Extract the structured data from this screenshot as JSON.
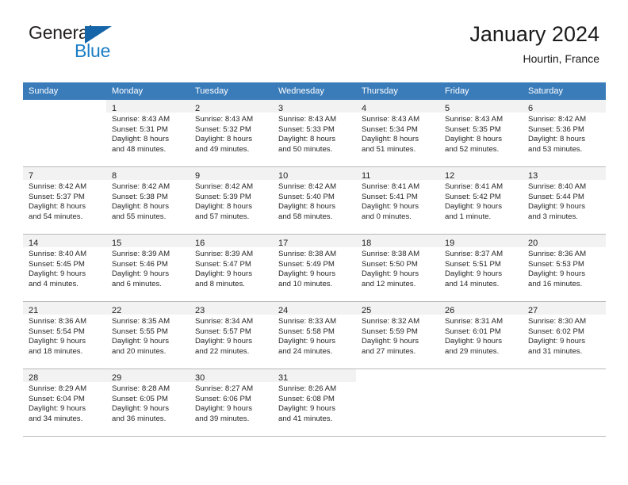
{
  "brand": {
    "name_part1": "General",
    "name_part2": "Blue",
    "accent_color": "#1a7dc4",
    "flag_color": "#1565a8"
  },
  "header": {
    "title": "January 2024",
    "subtitle": "Hourtin, France"
  },
  "calendar": {
    "header_bg": "#3a7cba",
    "daynum_strip_bg": "#f2f2f2",
    "grid_line_color": "#b9b9b9",
    "weekday_headers": [
      "Sunday",
      "Monday",
      "Tuesday",
      "Wednesday",
      "Thursday",
      "Friday",
      "Saturday"
    ],
    "weeks": [
      [
        {
          "empty": true
        },
        {
          "day": "1",
          "sunrise": "Sunrise: 8:43 AM",
          "sunset": "Sunset: 5:31 PM",
          "daylight_line1": "Daylight: 8 hours",
          "daylight_line2": "and 48 minutes."
        },
        {
          "day": "2",
          "sunrise": "Sunrise: 8:43 AM",
          "sunset": "Sunset: 5:32 PM",
          "daylight_line1": "Daylight: 8 hours",
          "daylight_line2": "and 49 minutes."
        },
        {
          "day": "3",
          "sunrise": "Sunrise: 8:43 AM",
          "sunset": "Sunset: 5:33 PM",
          "daylight_line1": "Daylight: 8 hours",
          "daylight_line2": "and 50 minutes."
        },
        {
          "day": "4",
          "sunrise": "Sunrise: 8:43 AM",
          "sunset": "Sunset: 5:34 PM",
          "daylight_line1": "Daylight: 8 hours",
          "daylight_line2": "and 51 minutes."
        },
        {
          "day": "5",
          "sunrise": "Sunrise: 8:43 AM",
          "sunset": "Sunset: 5:35 PM",
          "daylight_line1": "Daylight: 8 hours",
          "daylight_line2": "and 52 minutes."
        },
        {
          "day": "6",
          "sunrise": "Sunrise: 8:42 AM",
          "sunset": "Sunset: 5:36 PM",
          "daylight_line1": "Daylight: 8 hours",
          "daylight_line2": "and 53 minutes."
        }
      ],
      [
        {
          "day": "7",
          "sunrise": "Sunrise: 8:42 AM",
          "sunset": "Sunset: 5:37 PM",
          "daylight_line1": "Daylight: 8 hours",
          "daylight_line2": "and 54 minutes."
        },
        {
          "day": "8",
          "sunrise": "Sunrise: 8:42 AM",
          "sunset": "Sunset: 5:38 PM",
          "daylight_line1": "Daylight: 8 hours",
          "daylight_line2": "and 55 minutes."
        },
        {
          "day": "9",
          "sunrise": "Sunrise: 8:42 AM",
          "sunset": "Sunset: 5:39 PM",
          "daylight_line1": "Daylight: 8 hours",
          "daylight_line2": "and 57 minutes."
        },
        {
          "day": "10",
          "sunrise": "Sunrise: 8:42 AM",
          "sunset": "Sunset: 5:40 PM",
          "daylight_line1": "Daylight: 8 hours",
          "daylight_line2": "and 58 minutes."
        },
        {
          "day": "11",
          "sunrise": "Sunrise: 8:41 AM",
          "sunset": "Sunset: 5:41 PM",
          "daylight_line1": "Daylight: 9 hours",
          "daylight_line2": "and 0 minutes."
        },
        {
          "day": "12",
          "sunrise": "Sunrise: 8:41 AM",
          "sunset": "Sunset: 5:42 PM",
          "daylight_line1": "Daylight: 9 hours",
          "daylight_line2": "and 1 minute."
        },
        {
          "day": "13",
          "sunrise": "Sunrise: 8:40 AM",
          "sunset": "Sunset: 5:44 PM",
          "daylight_line1": "Daylight: 9 hours",
          "daylight_line2": "and 3 minutes."
        }
      ],
      [
        {
          "day": "14",
          "sunrise": "Sunrise: 8:40 AM",
          "sunset": "Sunset: 5:45 PM",
          "daylight_line1": "Daylight: 9 hours",
          "daylight_line2": "and 4 minutes."
        },
        {
          "day": "15",
          "sunrise": "Sunrise: 8:39 AM",
          "sunset": "Sunset: 5:46 PM",
          "daylight_line1": "Daylight: 9 hours",
          "daylight_line2": "and 6 minutes."
        },
        {
          "day": "16",
          "sunrise": "Sunrise: 8:39 AM",
          "sunset": "Sunset: 5:47 PM",
          "daylight_line1": "Daylight: 9 hours",
          "daylight_line2": "and 8 minutes."
        },
        {
          "day": "17",
          "sunrise": "Sunrise: 8:38 AM",
          "sunset": "Sunset: 5:49 PM",
          "daylight_line1": "Daylight: 9 hours",
          "daylight_line2": "and 10 minutes."
        },
        {
          "day": "18",
          "sunrise": "Sunrise: 8:38 AM",
          "sunset": "Sunset: 5:50 PM",
          "daylight_line1": "Daylight: 9 hours",
          "daylight_line2": "and 12 minutes."
        },
        {
          "day": "19",
          "sunrise": "Sunrise: 8:37 AM",
          "sunset": "Sunset: 5:51 PM",
          "daylight_line1": "Daylight: 9 hours",
          "daylight_line2": "and 14 minutes."
        },
        {
          "day": "20",
          "sunrise": "Sunrise: 8:36 AM",
          "sunset": "Sunset: 5:53 PM",
          "daylight_line1": "Daylight: 9 hours",
          "daylight_line2": "and 16 minutes."
        }
      ],
      [
        {
          "day": "21",
          "sunrise": "Sunrise: 8:36 AM",
          "sunset": "Sunset: 5:54 PM",
          "daylight_line1": "Daylight: 9 hours",
          "daylight_line2": "and 18 minutes."
        },
        {
          "day": "22",
          "sunrise": "Sunrise: 8:35 AM",
          "sunset": "Sunset: 5:55 PM",
          "daylight_line1": "Daylight: 9 hours",
          "daylight_line2": "and 20 minutes."
        },
        {
          "day": "23",
          "sunrise": "Sunrise: 8:34 AM",
          "sunset": "Sunset: 5:57 PM",
          "daylight_line1": "Daylight: 9 hours",
          "daylight_line2": "and 22 minutes."
        },
        {
          "day": "24",
          "sunrise": "Sunrise: 8:33 AM",
          "sunset": "Sunset: 5:58 PM",
          "daylight_line1": "Daylight: 9 hours",
          "daylight_line2": "and 24 minutes."
        },
        {
          "day": "25",
          "sunrise": "Sunrise: 8:32 AM",
          "sunset": "Sunset: 5:59 PM",
          "daylight_line1": "Daylight: 9 hours",
          "daylight_line2": "and 27 minutes."
        },
        {
          "day": "26",
          "sunrise": "Sunrise: 8:31 AM",
          "sunset": "Sunset: 6:01 PM",
          "daylight_line1": "Daylight: 9 hours",
          "daylight_line2": "and 29 minutes."
        },
        {
          "day": "27",
          "sunrise": "Sunrise: 8:30 AM",
          "sunset": "Sunset: 6:02 PM",
          "daylight_line1": "Daylight: 9 hours",
          "daylight_line2": "and 31 minutes."
        }
      ],
      [
        {
          "day": "28",
          "sunrise": "Sunrise: 8:29 AM",
          "sunset": "Sunset: 6:04 PM",
          "daylight_line1": "Daylight: 9 hours",
          "daylight_line2": "and 34 minutes."
        },
        {
          "day": "29",
          "sunrise": "Sunrise: 8:28 AM",
          "sunset": "Sunset: 6:05 PM",
          "daylight_line1": "Daylight: 9 hours",
          "daylight_line2": "and 36 minutes."
        },
        {
          "day": "30",
          "sunrise": "Sunrise: 8:27 AM",
          "sunset": "Sunset: 6:06 PM",
          "daylight_line1": "Daylight: 9 hours",
          "daylight_line2": "and 39 minutes."
        },
        {
          "day": "31",
          "sunrise": "Sunrise: 8:26 AM",
          "sunset": "Sunset: 6:08 PM",
          "daylight_line1": "Daylight: 9 hours",
          "daylight_line2": "and 41 minutes."
        },
        {
          "empty": true
        },
        {
          "empty": true
        },
        {
          "empty": true
        }
      ]
    ]
  }
}
